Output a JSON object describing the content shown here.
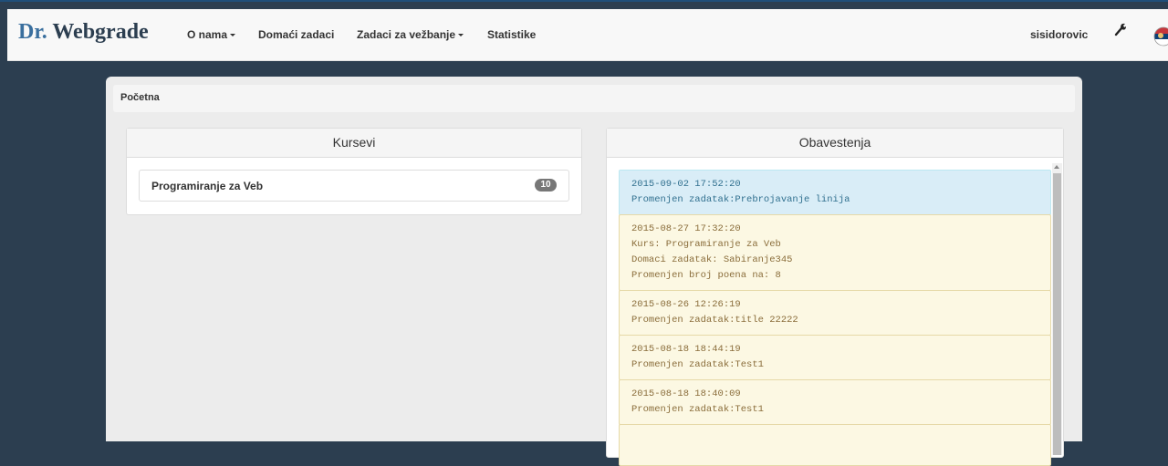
{
  "navbar": {
    "brand_prefix": "Dr.",
    "brand_name": "Webgrade",
    "items": [
      {
        "label": "O nama",
        "dropdown": true
      },
      {
        "label": "Domaći zadaci",
        "dropdown": false
      },
      {
        "label": "Zadaci za vežbanje",
        "dropdown": true
      },
      {
        "label": "Statistike",
        "dropdown": false
      }
    ],
    "user": "sisidorovic",
    "settings_icon": "wrench-icon",
    "language_icon": "serbia-flag-icon"
  },
  "breadcrumb": {
    "label": "Početna"
  },
  "courses": {
    "title": "Kursevi",
    "items": [
      {
        "label": "Programiranje za Veb",
        "count": "10"
      }
    ]
  },
  "notifications": {
    "title": "Obavestenja",
    "items": [
      {
        "kind": "info",
        "lines": [
          "2015-09-02 17:52:20",
          "Promenjen zadatak:Prebrojavanje linija"
        ]
      },
      {
        "kind": "warning",
        "lines": [
          "2015-08-27 17:32:20",
          "Kurs: Programiranje za Veb",
          "Domaci zadatak: Sabiranje345",
          "Promenjen broj poena na: 8"
        ]
      },
      {
        "kind": "warning",
        "lines": [
          "2015-08-26 12:26:19",
          "Promenjen zadatak:title 22222"
        ]
      },
      {
        "kind": "warning",
        "lines": [
          "2015-08-18 18:44:19",
          "Promenjen zadatak:Test1"
        ]
      },
      {
        "kind": "warning",
        "lines": [
          "2015-08-18 18:40:09",
          "Promenjen zadatak:Test1"
        ]
      }
    ]
  },
  "colors": {
    "background": "#2c3e50",
    "info_bg": "#d9edf7",
    "warning_bg": "#fcf8e3",
    "warning_text": "#8a6d3b",
    "info_text": "#31708f"
  }
}
